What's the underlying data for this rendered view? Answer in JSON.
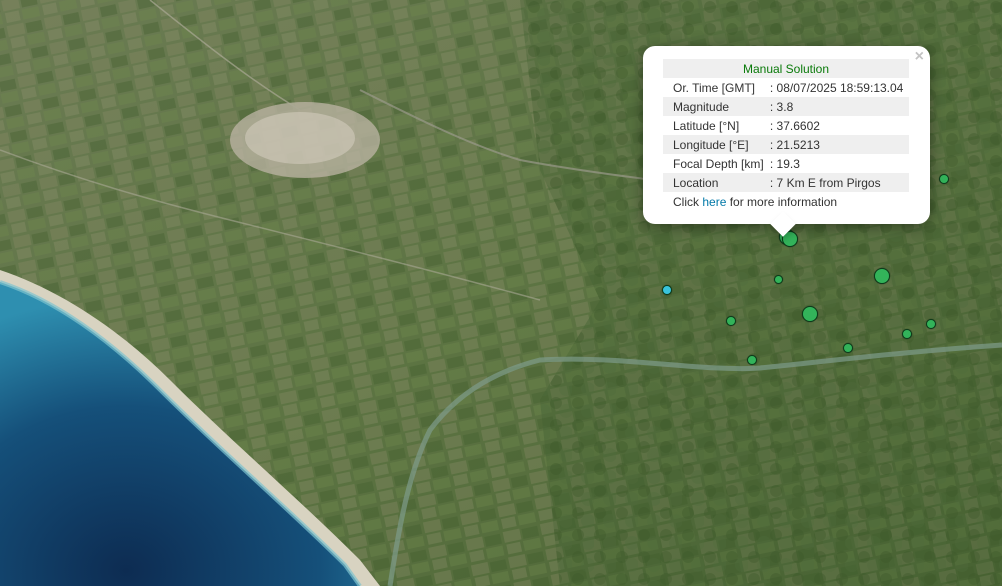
{
  "popup": {
    "close_label": "×",
    "title": "Manual Solution",
    "rows": [
      {
        "label": "Or. Time [GMT]",
        "value": ": 08/07/2025 18:59:13.04"
      },
      {
        "label": "Magnitude",
        "value": ": 3.8"
      },
      {
        "label": "Latitude [°N]",
        "value": ": 37.6602"
      },
      {
        "label": "Longitude [°E]",
        "value": ": 21.5213"
      },
      {
        "label": "Focal Depth [km]",
        "value": ": 19.3"
      },
      {
        "label": "Location",
        "value": ": 7 Km E from Pirgos"
      }
    ],
    "more_prefix": "Click ",
    "more_link": "here",
    "more_suffix": " for more information"
  },
  "colors": {
    "marker_green": "#33b35a",
    "marker_cyan": "#39c4dc",
    "title_green": "#0a7a0a",
    "link_blue": "#0078a8"
  }
}
